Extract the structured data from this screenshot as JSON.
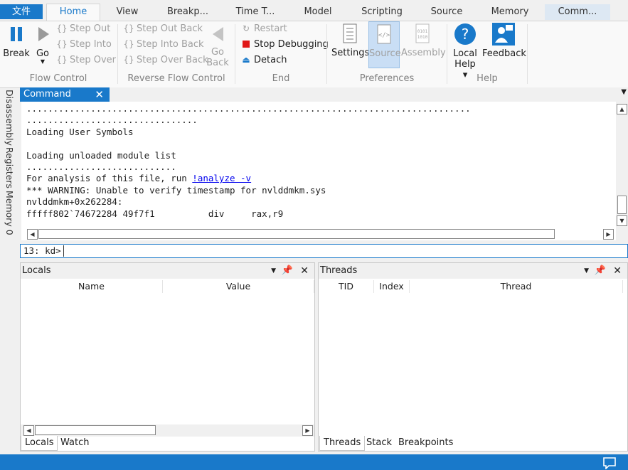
{
  "tabs": {
    "file": "文件",
    "home": "Home",
    "view": "View",
    "breakpoints": "Breakp...",
    "time_travel": "Time T...",
    "model": "Model",
    "scripting": "Scripting",
    "source": "Source",
    "memory": "Memory",
    "command": "Comm..."
  },
  "ribbon": {
    "flow_control": {
      "label": "Flow Control",
      "break": "Break",
      "go": "Go",
      "step_out": "Step Out",
      "step_into": "Step Into",
      "step_over": "Step Over"
    },
    "reverse_flow_control": {
      "label": "Reverse Flow Control",
      "step_out_back": "Step Out Back",
      "step_into_back": "Step Into Back",
      "step_over_back": "Step Over Back",
      "go_back_1": "Go",
      "go_back_2": "Back"
    },
    "end": {
      "label": "End",
      "restart": "Restart",
      "stop_debugging": "Stop Debugging",
      "detach": "Detach"
    },
    "preferences": {
      "label": "Preferences",
      "settings": "Settings",
      "source": "Source",
      "assembly": "Assembly"
    },
    "help": {
      "label": "Help",
      "local_help_1": "Local",
      "local_help_2": "Help ▾",
      "feedback": "Feedback"
    }
  },
  "side_tabs": [
    "Disassembly",
    "Registers",
    "Memory 0"
  ],
  "command": {
    "title": "Command",
    "lines_before_link": "...................................................................................\n................................\nLoading User Symbols\n\nLoading unloaded module list\n............................\nFor analysis of this file, run ",
    "link": "!analyze -v",
    "lines_after_link": "\n*** WARNING: Unable to verify timestamp for nvlddmkm.sys\nnvlddmkm+0x262284:\nfffff802`74672284 49f7f1          div     rax,r9",
    "prompt": "13: kd>",
    "input_value": ""
  },
  "locals": {
    "title": "Locals",
    "columns": [
      "Name",
      "Value"
    ],
    "tabs": [
      "Locals",
      "Watch"
    ]
  },
  "threads": {
    "title": "Threads",
    "columns": [
      "TID",
      "Index",
      "Thread"
    ],
    "tabs": [
      "Threads",
      "Stack",
      "Breakpoints"
    ]
  },
  "colors": {
    "accent": "#1979ca",
    "stop_red": "#e01818"
  }
}
